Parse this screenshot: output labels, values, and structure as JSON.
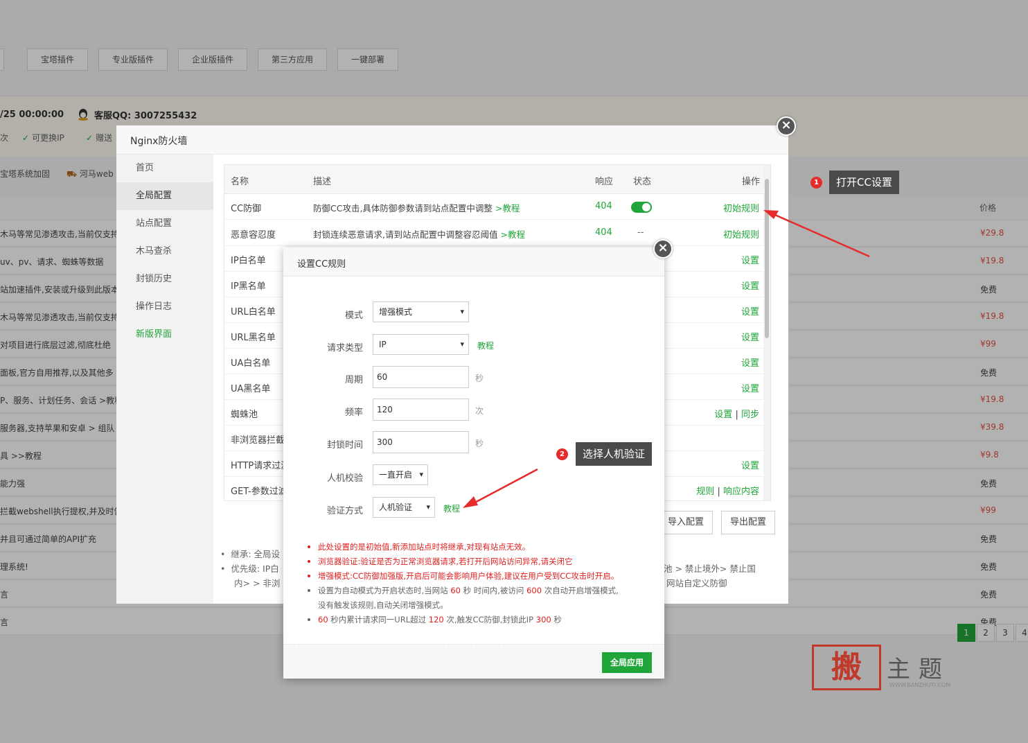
{
  "background": {
    "tabs": [
      "具",
      "宝塔插件",
      "专业版插件",
      "企业版插件",
      "第三方应用",
      "一键部署"
    ],
    "expire_date": "/25 00:00:00",
    "support_qq": "客服QQ: 3007255432",
    "features": [
      "次",
      "可更换IP",
      "赠送"
    ],
    "row2": [
      "宝塔系统加固",
      "河马web"
    ],
    "price_header": "价格",
    "rows": [
      {
        "desc": "木马等常见渗透攻击,当前仅支持",
        "price": "¥29.8"
      },
      {
        "desc": "uv、pv、请求、蜘蛛等数据",
        "price": "¥19.8"
      },
      {
        "desc": "站加速插件,安装或升级到此版本",
        "price": "免费"
      },
      {
        "desc": "木马等常见渗透攻击,当前仅支持",
        "price": "¥19.8"
      },
      {
        "desc": "对项目进行底层过滤,彻底杜绝",
        "price": "¥99"
      },
      {
        "desc": "面板,官方自用推荐,以及其他多",
        "price": "免费"
      },
      {
        "desc": "P、服务、计划任务、会话 >教程",
        "price": "¥19.8"
      },
      {
        "desc": "服务器,支持苹果和安卓 > 组队",
        "price": "¥39.8"
      },
      {
        "desc": "具 >>教程",
        "price": "¥9.8"
      },
      {
        "desc": "能力强",
        "price": "免费"
      },
      {
        "desc": "拦截webshell执行提权,并及时告",
        "price": "¥99"
      },
      {
        "desc": "并且可通过简单的API扩充",
        "price": "免费"
      },
      {
        "desc": "理系统!",
        "price": "免费"
      },
      {
        "desc": "言",
        "price": "免费"
      },
      {
        "desc": "言",
        "price": "免费"
      }
    ],
    "pages": [
      "1",
      "2",
      "3",
      "4"
    ],
    "watermark": {
      "seal": "搬",
      "text": "主题",
      "url": "WWW.BANZHUTI.COM"
    }
  },
  "firewall": {
    "title": "Nginx防火墙",
    "nav": [
      "首页",
      "全局配置",
      "站点配置",
      "木马查杀",
      "封锁历史",
      "操作日志",
      "新版界面"
    ],
    "columns": {
      "name": "名称",
      "desc": "描述",
      "response": "响应",
      "status": "状态",
      "action": "操作"
    },
    "rows": [
      {
        "name": "CC防御",
        "desc": "防御CC攻击,具体防御参数请到站点配置中调整",
        "desc_link": ">教程",
        "response": "404",
        "status": "on",
        "action": "初始规则"
      },
      {
        "name": "恶意容忍度",
        "desc": "封锁连续恶意请求,请到站点配置中调整容忍阈值",
        "desc_link": ">教程",
        "response": "404",
        "status": "--",
        "action": "初始规则"
      },
      {
        "name": "IP白名单",
        "action": "设置"
      },
      {
        "name": "IP黑名单",
        "action": "设置"
      },
      {
        "name": "URL白名单",
        "action": "设置"
      },
      {
        "name": "URL黑名单",
        "action": "设置"
      },
      {
        "name": "UA白名单",
        "action": "设置"
      },
      {
        "name": "UA黑名单",
        "action": "设置"
      },
      {
        "name": "蜘蛛池",
        "action": "设置",
        "action2": "同步"
      },
      {
        "name": "非浏览器拦截"
      },
      {
        "name": "HTTP请求过滤",
        "action": "设置"
      },
      {
        "name": "GET-参数过滤",
        "action": "规则",
        "action2": "响应内容"
      }
    ],
    "buttons": {
      "import": "导入配置",
      "export": "导出配置"
    },
    "notes": [
      {
        "left": "继承: 全局设",
        "right": ""
      },
      {
        "left": "优先级: IP白",
        "right": "池 > 禁止境外> 禁止国"
      },
      {
        "left": "内> > 非浏",
        "right": "网站自定义防御"
      }
    ]
  },
  "cc_dialog": {
    "title": "设置CC规则",
    "mode": {
      "label": "模式",
      "value": "增强模式"
    },
    "request_type": {
      "label": "请求类型",
      "value": "IP",
      "link": "教程"
    },
    "period": {
      "label": "周期",
      "value": "60",
      "unit": "秒"
    },
    "frequency": {
      "label": "频率",
      "value": "120",
      "unit": "次"
    },
    "block_time": {
      "label": "封锁时间",
      "value": "300",
      "unit": "秒"
    },
    "captcha": {
      "label": "人机校验",
      "value": "一直开启"
    },
    "verify": {
      "label": "验证方式",
      "value": "人机验证",
      "link": "教程"
    },
    "notes": {
      "n1": "此处设置的是初始值,新添加站点时将继承,对现有站点无效。",
      "n2": "浏览器验证:验证是否为正常浏览器请求,若打开后网站访问异常,请关闭它",
      "n3": "增强模式:CC防御加强版,开启后可能会影响用户体验,建议在用户受到CC攻击时开启。",
      "n4_a": "设置为自动模式为开启状态时,当网站",
      "n4_b": "60",
      "n4_c": "秒 时间内,被访问",
      "n4_d": "600",
      "n4_e": "次自动开启增强模式,",
      "n5": "没有触发该规则,自动关闭增强模式。",
      "n6_a": "60",
      "n6_b": "秒内累计请求同一URL超过",
      "n6_c": "120",
      "n6_d": "次,触发CC防御,封锁此IP",
      "n6_e": "300",
      "n6_f": "秒"
    },
    "apply_button": "全局应用"
  },
  "annotations": {
    "step1": {
      "num": "1",
      "text": "打开CC设置"
    },
    "step2": {
      "num": "2",
      "text": "选择人机验证"
    }
  },
  "close_glyph": "×",
  "colors": {
    "accent": "#20a53a",
    "danger": "#e02020",
    "tooltip": "#4a4a4a"
  }
}
